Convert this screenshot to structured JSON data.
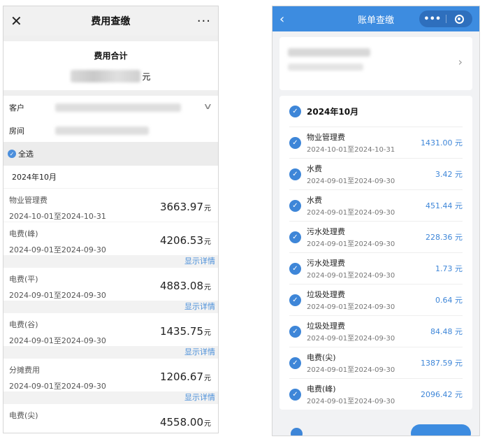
{
  "left": {
    "nav": {
      "close_icon": "close-icon",
      "title": "费用查缴",
      "more": "···"
    },
    "total": {
      "label": "费用合计",
      "unit": "元"
    },
    "fields": [
      {
        "label": "客户"
      },
      {
        "label": "房间"
      }
    ],
    "select_all": "全选",
    "month": "2024年10月",
    "items": [
      {
        "name": "物业管理费",
        "date": "2024-10-01至2024-10-31",
        "amount": "3663.97",
        "unit": "元",
        "detail": ""
      },
      {
        "name": "电费(峰)",
        "date": "2024-09-01至2024-09-30",
        "amount": "4206.53",
        "unit": "元",
        "detail": "显示详情"
      },
      {
        "name": "电费(平)",
        "date": "2024-09-01至2024-09-30",
        "amount": "4883.08",
        "unit": "元",
        "detail": "显示详情"
      },
      {
        "name": "电费(谷)",
        "date": "2024-09-01至2024-09-30",
        "amount": "1435.75",
        "unit": "元",
        "detail": "显示详情"
      },
      {
        "name": "分摊费用",
        "date": "2024-09-01至2024-09-30",
        "amount": "1206.67",
        "unit": "元",
        "detail": "显示详情"
      },
      {
        "name": "电费(尖)",
        "date": "",
        "amount": "4558.00",
        "unit": "元",
        "detail": ""
      }
    ]
  },
  "right": {
    "nav": {
      "back": "‹",
      "title": "账单查缴",
      "dots": "•••"
    },
    "month": "2024年10月",
    "items": [
      {
        "name": "物业管理费",
        "date": "2024-10-01至2024-10-31",
        "amount": "1431.00 元"
      },
      {
        "name": "水费",
        "date": "2024-09-01至2024-09-30",
        "amount": "3.42 元"
      },
      {
        "name": "水费",
        "date": "2024-09-01至2024-09-30",
        "amount": "451.44 元"
      },
      {
        "name": "污水处理费",
        "date": "2024-09-01至2024-09-30",
        "amount": "228.36 元"
      },
      {
        "name": "污水处理费",
        "date": "2024-09-01至2024-09-30",
        "amount": "1.73 元"
      },
      {
        "name": "垃圾处理费",
        "date": "2024-09-01至2024-09-30",
        "amount": "0.64 元"
      },
      {
        "name": "垃圾处理费",
        "date": "2024-09-01至2024-09-30",
        "amount": "84.48 元"
      },
      {
        "name": "电费(尖)",
        "date": "2024-09-01至2024-09-30",
        "amount": "1387.59 元"
      },
      {
        "name": "电费(峰)",
        "date": "2024-09-01至2024-09-30",
        "amount": "2096.42 元"
      }
    ]
  }
}
